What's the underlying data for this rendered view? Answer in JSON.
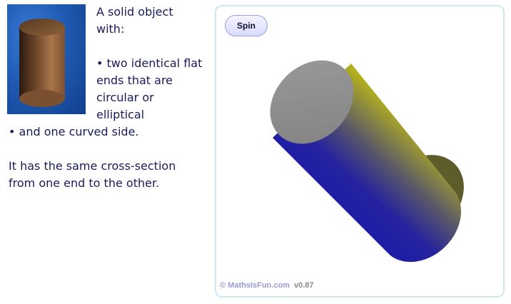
{
  "intro": {
    "line1": "A solid object",
    "line2": "with:"
  },
  "features": [
    "• two identical flat",
    "ends that are",
    "circular or",
    "elliptical",
    "• and one curved side."
  ],
  "summary": {
    "line1": "It has the same cross-section",
    "line2": "from one end to the other."
  },
  "panel": {
    "spin_label": "Spin",
    "credit": "© MathsIsFun.com",
    "version": "v0.87"
  },
  "colors": {
    "text": "#1a1a5e",
    "cylinder_blue": "#1c1ca8",
    "cylinder_yellow": "#b5b21e",
    "cylinder_end": "#8e8e8e",
    "panel_border": "#cfe6f3"
  }
}
